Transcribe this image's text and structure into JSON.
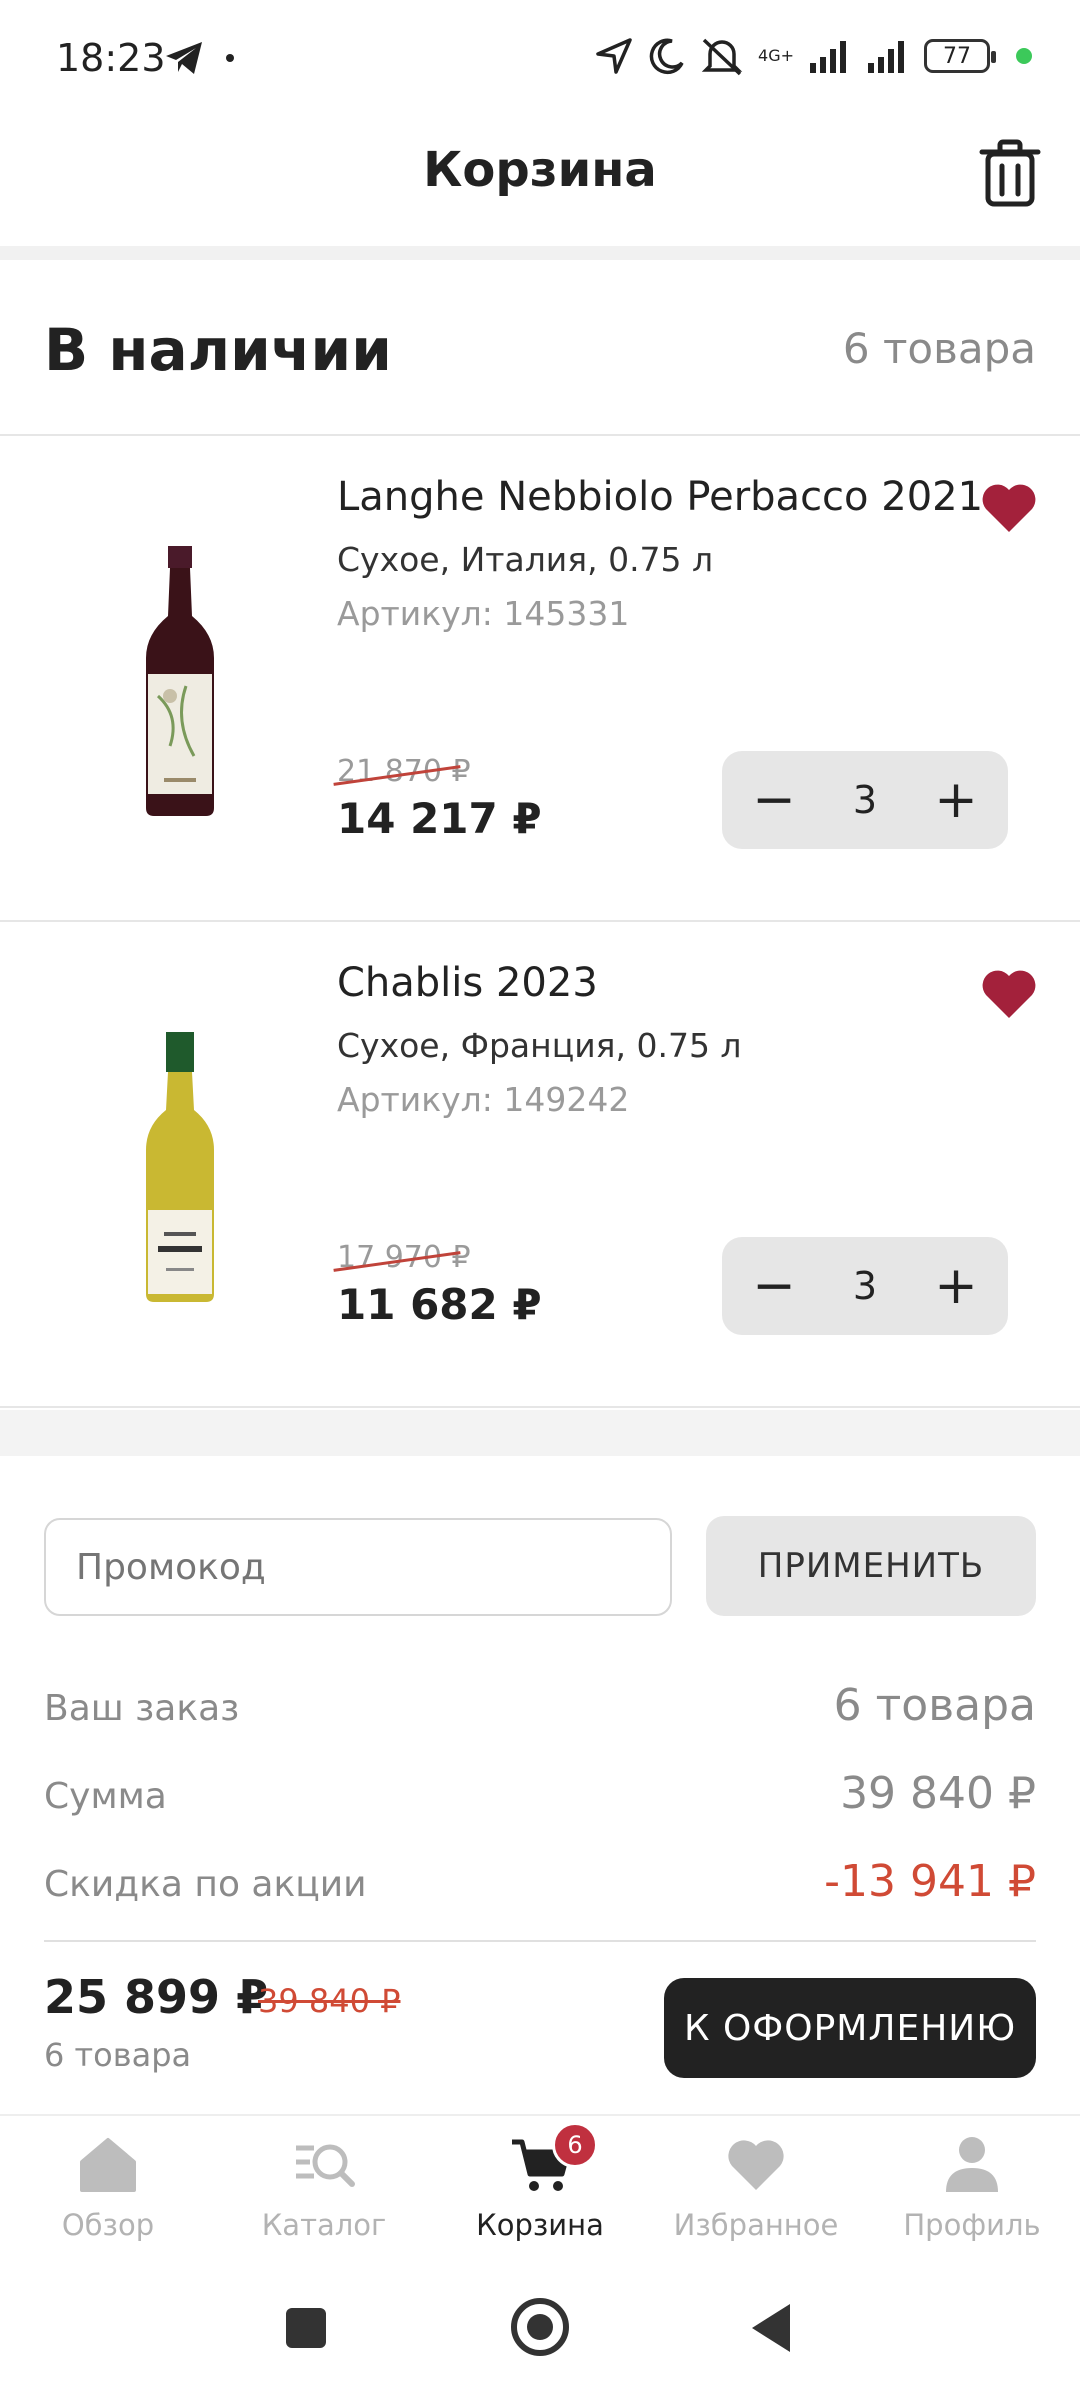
{
  "status_bar": {
    "time": "18:23",
    "network": "4G+",
    "battery": "77",
    "icons": [
      "telegram-icon",
      "location-icon",
      "moon-icon",
      "muted-icon",
      "signal-icon",
      "battery-icon"
    ]
  },
  "header": {
    "title": "Корзина",
    "trash_icon": "trash-icon"
  },
  "section": {
    "title": "В наличии",
    "count": "6 товара"
  },
  "items": [
    {
      "name": "Langhe Nebbiolo Perbacco 2021",
      "desc": "Сухое, Италия, 0.75 л",
      "sku": "Артикул: 145331",
      "old_price": "21 870 ₽",
      "new_price": "14 217 ₽",
      "qty": "3",
      "minus": "−",
      "plus": "+"
    },
    {
      "name": "Chablis 2023",
      "desc": "Сухое, Франция, 0.75 л",
      "sku": "Артикул: 149242",
      "old_price": "17 970 ₽",
      "new_price": "11 682 ₽",
      "qty": "3",
      "minus": "−",
      "plus": "+"
    }
  ],
  "promo": {
    "placeholder": "Промокод",
    "apply_label": "ПРИМЕНИТЬ"
  },
  "summary": {
    "order_label": "Ваш заказ",
    "order_value": "6 товара",
    "sum_label": "Сумма",
    "sum_value": "39 840 ₽",
    "discount_label": "Скидка по акции",
    "discount_value": "-13 941 ₽"
  },
  "footer": {
    "total": "25 899 ₽",
    "total_old": "39 840 ₽",
    "count": "6 товара",
    "checkout_label": "К ОФОРМЛЕНИЮ"
  },
  "bottom_nav": {
    "items": [
      {
        "label": "Обзор",
        "icon": "home-icon"
      },
      {
        "label": "Каталог",
        "icon": "catalog-search-icon"
      },
      {
        "label": "Корзина",
        "icon": "cart-icon",
        "badge": "6"
      },
      {
        "label": "Избранное",
        "icon": "heart-icon"
      },
      {
        "label": "Профиль",
        "icon": "profile-icon"
      }
    ]
  },
  "colors": {
    "accent": "#a3213b",
    "discount": "#d04a35",
    "dark_button": "#222222"
  }
}
